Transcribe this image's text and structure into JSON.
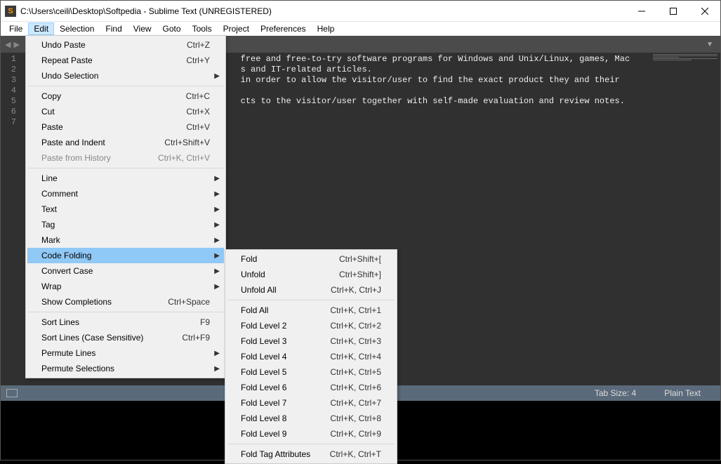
{
  "titlebar": {
    "title": "C:\\Users\\ceili\\Desktop\\Softpedia - Sublime Text (UNREGISTERED)"
  },
  "menubar": {
    "items": [
      "File",
      "Edit",
      "Selection",
      "Find",
      "View",
      "Goto",
      "Tools",
      "Project",
      "Preferences",
      "Help"
    ],
    "active_index": 1
  },
  "gutter": {
    "lines": [
      "1",
      "2",
      "3",
      "4",
      "5",
      "6",
      "7"
    ]
  },
  "code": {
    "lines": [
      "free and free-to-try software programs for Windows and Unix/Linux, games, Mac",
      "s and IT-related articles.",
      "in order to allow the visitor/user to find the exact product they and their",
      "",
      "cts to the visitor/user together with self-made evaluation and review notes.",
      "",
      ""
    ]
  },
  "statusbar": {
    "tab_size": "Tab Size: 4",
    "syntax": "Plain Text"
  },
  "edit_menu": {
    "groups": [
      [
        {
          "label": "Undo Paste",
          "shortcut": "Ctrl+Z"
        },
        {
          "label": "Repeat Paste",
          "shortcut": "Ctrl+Y"
        },
        {
          "label": "Undo Selection",
          "submenu": true
        }
      ],
      [
        {
          "label": "Copy",
          "shortcut": "Ctrl+C"
        },
        {
          "label": "Cut",
          "shortcut": "Ctrl+X"
        },
        {
          "label": "Paste",
          "shortcut": "Ctrl+V"
        },
        {
          "label": "Paste and Indent",
          "shortcut": "Ctrl+Shift+V"
        },
        {
          "label": "Paste from History",
          "shortcut": "Ctrl+K, Ctrl+V",
          "disabled": true
        }
      ],
      [
        {
          "label": "Line",
          "submenu": true
        },
        {
          "label": "Comment",
          "submenu": true
        },
        {
          "label": "Text",
          "submenu": true
        },
        {
          "label": "Tag",
          "submenu": true
        },
        {
          "label": "Mark",
          "submenu": true
        },
        {
          "label": "Code Folding",
          "submenu": true,
          "highlighted": true
        },
        {
          "label": "Convert Case",
          "submenu": true
        },
        {
          "label": "Wrap",
          "submenu": true
        },
        {
          "label": "Show Completions",
          "shortcut": "Ctrl+Space"
        }
      ],
      [
        {
          "label": "Sort Lines",
          "shortcut": "F9"
        },
        {
          "label": "Sort Lines (Case Sensitive)",
          "shortcut": "Ctrl+F9"
        },
        {
          "label": "Permute Lines",
          "submenu": true
        },
        {
          "label": "Permute Selections",
          "submenu": true
        }
      ]
    ]
  },
  "code_folding_submenu": {
    "groups": [
      [
        {
          "label": "Fold",
          "shortcut": "Ctrl+Shift+["
        },
        {
          "label": "Unfold",
          "shortcut": "Ctrl+Shift+]"
        },
        {
          "label": "Unfold All",
          "shortcut": "Ctrl+K, Ctrl+J"
        }
      ],
      [
        {
          "label": "Fold All",
          "shortcut": "Ctrl+K, Ctrl+1"
        },
        {
          "label": "Fold Level 2",
          "shortcut": "Ctrl+K, Ctrl+2"
        },
        {
          "label": "Fold Level 3",
          "shortcut": "Ctrl+K, Ctrl+3"
        },
        {
          "label": "Fold Level 4",
          "shortcut": "Ctrl+K, Ctrl+4"
        },
        {
          "label": "Fold Level 5",
          "shortcut": "Ctrl+K, Ctrl+5"
        },
        {
          "label": "Fold Level 6",
          "shortcut": "Ctrl+K, Ctrl+6"
        },
        {
          "label": "Fold Level 7",
          "shortcut": "Ctrl+K, Ctrl+7"
        },
        {
          "label": "Fold Level 8",
          "shortcut": "Ctrl+K, Ctrl+8"
        },
        {
          "label": "Fold Level 9",
          "shortcut": "Ctrl+K, Ctrl+9"
        }
      ],
      [
        {
          "label": "Fold Tag Attributes",
          "shortcut": "Ctrl+K, Ctrl+T"
        }
      ]
    ]
  }
}
